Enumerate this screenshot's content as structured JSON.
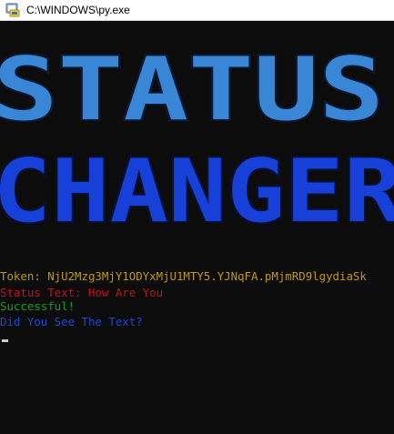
{
  "window": {
    "title": "C:\\WINDOWS\\py.exe",
    "icon": "python-icon"
  },
  "banner": {
    "line1": "STATUS",
    "line2": "CHANGER",
    "line1_color": "#3a86d6",
    "line2_color": "#1640d8"
  },
  "console": {
    "lines": [
      {
        "text": "Token: NjU2Mzg3MjY1ODYxMjU1MTY5.YJNqFA.pMjmRD9lgydiaSk",
        "color": "#c19c00"
      },
      {
        "text": "Status Text: How Are You",
        "color": "#c50f1f"
      },
      {
        "text": "Successful!",
        "color": "#13a10e"
      },
      {
        "text": "Did You See The Text?",
        "color": "#1e48d2"
      }
    ]
  }
}
